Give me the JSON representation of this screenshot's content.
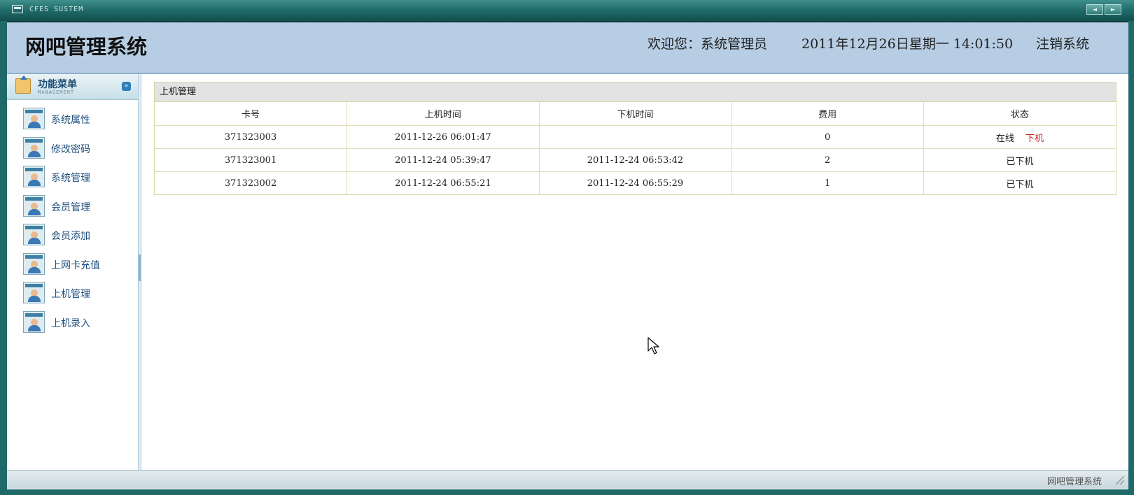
{
  "window": {
    "app_name": "CFES SUSTEM",
    "nav_prev": "◄",
    "nav_next": "►"
  },
  "header": {
    "title": "网吧管理系统",
    "welcome": "欢迎您：系统管理员",
    "datetime": "2011年12月26日星期一  14:01:50",
    "logout": "注销系统"
  },
  "sidebar": {
    "title": "功能菜单",
    "subtitle": "MANAGEMENT",
    "items": [
      {
        "label": "系统属性"
      },
      {
        "label": "修改密码"
      },
      {
        "label": "系统管理"
      },
      {
        "label": "会员管理"
      },
      {
        "label": "会员添加"
      },
      {
        "label": "上网卡充值"
      },
      {
        "label": "上机管理"
      },
      {
        "label": "上机录入"
      }
    ]
  },
  "panel": {
    "title": "上机管理",
    "columns": [
      "卡号",
      "上机时间",
      "下机时间",
      "费用",
      "状态"
    ],
    "rows": [
      {
        "card": "371323003",
        "start": "2011-12-26 06:01:47",
        "end": "",
        "fee": "0",
        "status": "在线",
        "action": "下机"
      },
      {
        "card": "371323001",
        "start": "2011-12-24 05:39:47",
        "end": "2011-12-24 06:53:42",
        "fee": "2",
        "status": "已下机"
      },
      {
        "card": "371323002",
        "start": "2011-12-24 06:55:21",
        "end": "2011-12-24 06:55:29",
        "fee": "1",
        "status": "已下机"
      }
    ]
  },
  "statusbar": {
    "text": "网吧管理系统"
  },
  "colors": {
    "frame": "#1f6a68",
    "header_bg": "#b7cde3",
    "menu_text": "#1f4f7c",
    "action_red": "#cc1b1b"
  },
  "icons": {
    "window": "window-icon",
    "menu_head": "upload-folder-icon",
    "collapse": "double-chevron-down-icon",
    "menu_item": "user-card-icon"
  }
}
